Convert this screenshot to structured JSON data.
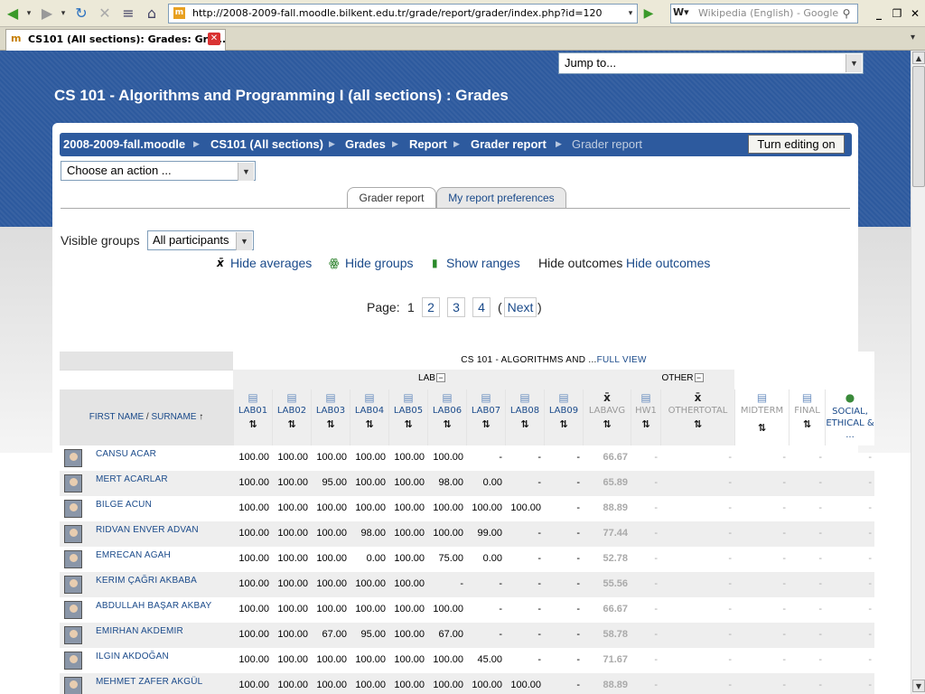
{
  "browser": {
    "url": "http://2008-2009-fall.moodle.bilkent.edu.tr/grade/report/grader/index.php?id=120",
    "search_placeholder": "Wikipedia (English) - Google",
    "tab_title": "CS101 (All sections): Grades: Gra..."
  },
  "page": {
    "jump_to": "Jump to...",
    "title": "CS 101 - Algorithms and Programming I (all sections) : Grades",
    "breadcrumb": [
      "2008-2009-fall.moodle",
      "CS101 (All sections)",
      "Grades",
      "Report",
      "Grader report",
      "Grader report"
    ],
    "turn_editing_on": "Turn editing on",
    "choose_action": "Choose an action ...",
    "tabs": [
      "Grader report",
      "My report preferences"
    ],
    "visible_groups_label": "Visible groups",
    "visible_groups_value": "All participants",
    "toggles": {
      "hide_averages": "Hide averages",
      "hide_groups": "Hide groups",
      "show_ranges": "Show ranges",
      "hide_outcomes_plain": "Hide outcomes",
      "hide_outcomes_link": "Hide outcomes"
    },
    "paging": {
      "label": "Page:",
      "current": "1",
      "pages": [
        "2",
        "3",
        "4"
      ],
      "open_paren": "(",
      "next": "Next",
      "close_paren": ")"
    }
  },
  "grader": {
    "course_header": "CS 101 - ALGORITHMS AND ...",
    "full_view": "FULL VIEW",
    "category_lab": "LAB",
    "category_other": "OTHER",
    "collapse_symbol": "−",
    "name_header": {
      "first": "FIRST NAME",
      "sep": " / ",
      "last": "SURNAME",
      "arrow": "↑"
    },
    "columns": [
      "LAB01",
      "LAB02",
      "LAB03",
      "LAB04",
      "LAB05",
      "LAB06",
      "LAB07",
      "LAB08",
      "LAB09",
      "LABAVG",
      "HW1",
      "OTHERTOTAL",
      "MIDTERM",
      "FINAL",
      "SOCIAL, ETHICAL & ..."
    ],
    "rows": [
      {
        "name": "CANSU ACAR",
        "grades": [
          "100.00",
          "100.00",
          "100.00",
          "100.00",
          "100.00",
          "100.00",
          "-",
          "-",
          "-",
          "66.67",
          "-",
          "-",
          "-",
          "-",
          "-"
        ]
      },
      {
        "name": "MERT ACARLAR",
        "grades": [
          "100.00",
          "100.00",
          "95.00",
          "100.00",
          "100.00",
          "98.00",
          "0.00",
          "-",
          "-",
          "65.89",
          "-",
          "-",
          "-",
          "-",
          "-"
        ]
      },
      {
        "name": "BILGE ACUN",
        "grades": [
          "100.00",
          "100.00",
          "100.00",
          "100.00",
          "100.00",
          "100.00",
          "100.00",
          "100.00",
          "-",
          "88.89",
          "-",
          "-",
          "-",
          "-",
          "-"
        ]
      },
      {
        "name": "RIDVAN ENVER ADVAN",
        "grades": [
          "100.00",
          "100.00",
          "100.00",
          "98.00",
          "100.00",
          "100.00",
          "99.00",
          "-",
          "-",
          "77.44",
          "-",
          "-",
          "-",
          "-",
          "-"
        ]
      },
      {
        "name": "EMRECAN AGAH",
        "grades": [
          "100.00",
          "100.00",
          "100.00",
          "0.00",
          "100.00",
          "75.00",
          "0.00",
          "-",
          "-",
          "52.78",
          "-",
          "-",
          "-",
          "-",
          "-"
        ]
      },
      {
        "name": "KERIM ÇAĞRI AKBABA",
        "grades": [
          "100.00",
          "100.00",
          "100.00",
          "100.00",
          "100.00",
          "-",
          "-",
          "-",
          "-",
          "55.56",
          "-",
          "-",
          "-",
          "-",
          "-"
        ]
      },
      {
        "name": "ABDULLAH BAŞAR AKBAY",
        "grades": [
          "100.00",
          "100.00",
          "100.00",
          "100.00",
          "100.00",
          "100.00",
          "-",
          "-",
          "-",
          "66.67",
          "-",
          "-",
          "-",
          "-",
          "-"
        ]
      },
      {
        "name": "EMIRHAN AKDEMIR",
        "grades": [
          "100.00",
          "100.00",
          "67.00",
          "95.00",
          "100.00",
          "67.00",
          "-",
          "-",
          "-",
          "58.78",
          "-",
          "-",
          "-",
          "-",
          "-"
        ]
      },
      {
        "name": "ILGIN AKDOĞAN",
        "grades": [
          "100.00",
          "100.00",
          "100.00",
          "100.00",
          "100.00",
          "100.00",
          "45.00",
          "-",
          "-",
          "71.67",
          "-",
          "-",
          "-",
          "-",
          "-"
        ]
      },
      {
        "name": "MEHMET ZAFER AKGÜL",
        "grades": [
          "100.00",
          "100.00",
          "100.00",
          "100.00",
          "100.00",
          "100.00",
          "100.00",
          "100.00",
          "-",
          "88.89",
          "-",
          "-",
          "-",
          "-",
          "-"
        ]
      }
    ]
  },
  "colors": {
    "header_blue": "#2d5a9e",
    "link_blue": "#1a4a8a",
    "row_alt": "#eeeeee"
  }
}
